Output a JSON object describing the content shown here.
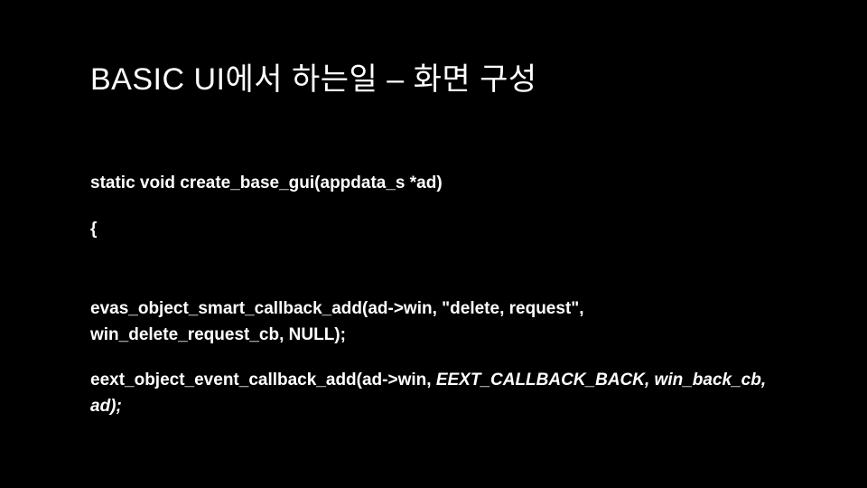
{
  "title": "BASIC UI에서 하는일 – 화면 구성",
  "code": {
    "line1": "static void create_base_gui(appdata_s *ad)",
    "line2": "{",
    "line3": "evas_object_smart_callback_add(ad->win, \"delete, request\", win_delete_request_cb, NULL);",
    "line4_regular": "eext_object_event_callback_add(ad->win, ",
    "line4_italic": "EEXT_CALLBACK_BACK, win_back_cb, ad);"
  }
}
